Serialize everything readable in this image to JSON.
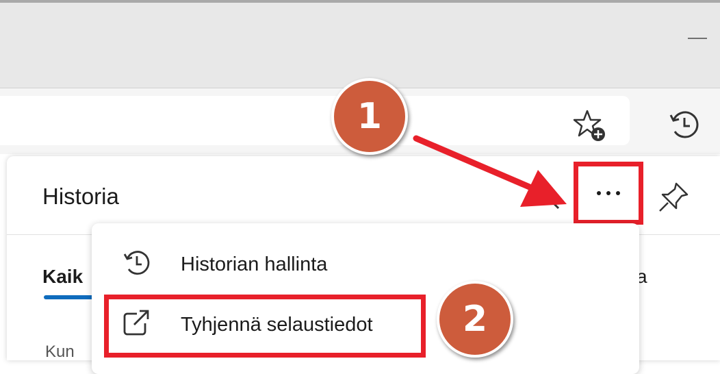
{
  "window": {
    "minimize_label": "—"
  },
  "history_panel": {
    "title": "Historia",
    "tabs": [
      {
        "label": "Kaik",
        "selected": true
      },
      {
        "label": "a",
        "selected": false
      }
    ],
    "list_first_text": "Kun"
  },
  "more_menu": {
    "items": [
      {
        "label": "Historian hallinta",
        "icon": "history-icon"
      },
      {
        "label": "Tyhjennä selaustiedot",
        "icon": "external-link-icon"
      }
    ]
  },
  "annotations": {
    "step1": "1",
    "step2": "2",
    "badge_color": "#cd5c3c",
    "highlight_color": "#e8202a"
  },
  "colors": {
    "accent": "#0f6cbd",
    "titlebar": "#e8e8e8"
  }
}
